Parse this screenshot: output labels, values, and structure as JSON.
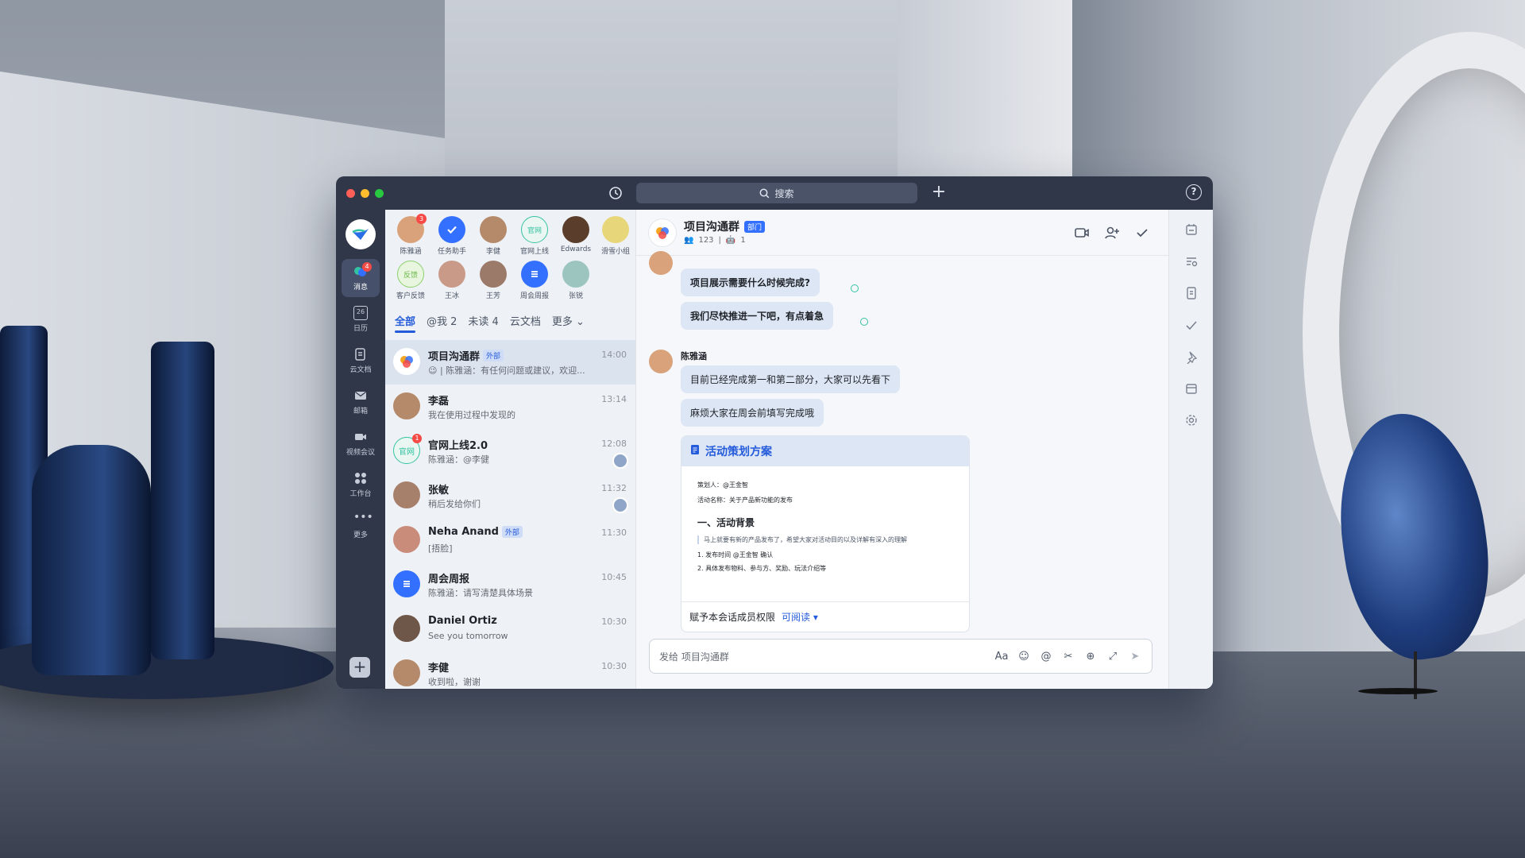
{
  "app": {
    "search_placeholder": "搜索",
    "help_label": "?",
    "add_label": "+"
  },
  "colors": {
    "accent": "#245bdb",
    "titlebar": "#2f3749",
    "badge": "#f54a45",
    "bubble": "#dde6f4"
  },
  "nav": {
    "items": [
      {
        "label": "消息",
        "icon": "chat-icon",
        "badge": "4",
        "active": true
      },
      {
        "label": "日历",
        "icon": "calendar-icon",
        "day": "26"
      },
      {
        "label": "云文档",
        "icon": "docs-icon"
      },
      {
        "label": "邮箱",
        "icon": "mail-icon"
      },
      {
        "label": "视频会议",
        "icon": "video-icon"
      },
      {
        "label": "工作台",
        "icon": "apps-icon"
      },
      {
        "label": "更多",
        "icon": "more-icon"
      }
    ]
  },
  "pinned": [
    {
      "label": "陈雅涵",
      "badge": "3",
      "color": "#d9a27a"
    },
    {
      "label": "任务助手",
      "color": "#3370ff",
      "icon": "check-icon"
    },
    {
      "label": "李健",
      "color": "#b58a6a"
    },
    {
      "label": "官网上线",
      "text": "官网",
      "color": "#e9f6f1"
    },
    {
      "label": "Edwards",
      "color": "#5a3d2b"
    },
    {
      "label": "滑雪小组",
      "color": "#e8d67a"
    },
    {
      "label": "客户反馈",
      "text": "反馈",
      "color": "#e9f6df"
    },
    {
      "label": "王冰",
      "color": "#c99a88"
    },
    {
      "label": "王芳",
      "color": "#9b7a6a"
    },
    {
      "label": "周会周报",
      "color": "#3370ff",
      "icon": "list-icon"
    },
    {
      "label": "张锐",
      "color": "#9cc5c0"
    }
  ],
  "tabs": [
    {
      "label": "全部",
      "active": true
    },
    {
      "label": "@我 2"
    },
    {
      "label": "未读 4"
    },
    {
      "label": "云文档"
    },
    {
      "label": "更多"
    }
  ],
  "chats": [
    {
      "name": "项目沟通群",
      "tag": "外部",
      "preview": "😉 | 陈雅涵：有任何问题或建议，欢迎...",
      "time": "14:00",
      "active": true,
      "color": "#ffffff"
    },
    {
      "name": "李磊",
      "preview": "我在使用过程中发现的",
      "time": "13:14",
      "color": "#b58a6a"
    },
    {
      "name": "官网上线2.0",
      "preview": "陈雅涵：@李健",
      "time": "12:08",
      "badge": "1",
      "mini": true,
      "color": "#e9f6f1",
      "avatar_text": "官网"
    },
    {
      "name": "张敏",
      "preview": "稍后发给你们",
      "time": "11:32",
      "mini": true,
      "color": "#a7806b"
    },
    {
      "name": "Neha Anand",
      "tag": "外部",
      "preview": "[捂脸]",
      "time": "11:30",
      "color": "#c98c7a"
    },
    {
      "name": "周会周报",
      "preview": "陈雅涵：请写清楚具体场景",
      "time": "10:45",
      "color": "#3370ff"
    },
    {
      "name": "Daniel Ortiz",
      "preview": "See you tomorrow",
      "time": "10:30",
      "color": "#6e5648"
    },
    {
      "name": "李健",
      "preview": "收到啦，谢谢",
      "time": "10:30",
      "color": "#b58a6a"
    }
  ],
  "conversation": {
    "title": "项目沟通群",
    "dept_tag": "部门",
    "members": "123",
    "bots": "1",
    "messages": [
      {
        "text": "项目展示需要什么时候完成?"
      },
      {
        "text": "我们尽快推进一下吧，有点着急"
      },
      {
        "sender": "陈雅涵"
      },
      {
        "text": "目前已经完成第一和第二部分，大家可以先看下"
      },
      {
        "text": "麻烦大家在周会前填写完成哦"
      }
    ],
    "doc": {
      "title": "活动策划方案",
      "planner": "策划人：@王金智",
      "activity": "活动名称：关于产品新功能的发布",
      "section": "一、活动背景",
      "quote": "马上就要有新的产品发布了，希望大家对活动目的以及详解有深入的理解",
      "list": [
        "1. 发布时间 @王金智 确认",
        "2. 具体发布物料、参与方、奖励、玩法介绍等"
      ],
      "permission_label": "赋予本会话成员权限",
      "permission_value": "可阅读"
    },
    "composer_placeholder": "发给 项目沟通群"
  }
}
